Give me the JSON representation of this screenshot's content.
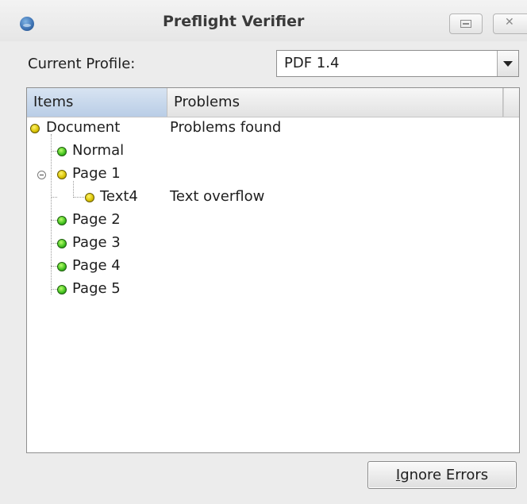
{
  "window": {
    "title": "Preflight Verifier"
  },
  "profile": {
    "label": "Current Profile:",
    "selected": "PDF 1.4"
  },
  "tree": {
    "columns": [
      "Items",
      "Problems"
    ],
    "rows": [
      {
        "label": "Document",
        "status": "yellow",
        "problem": "Problems found"
      },
      {
        "label": "Normal",
        "status": "green",
        "problem": ""
      },
      {
        "label": "Page 1",
        "status": "yellow",
        "problem": "",
        "expanded": true
      },
      {
        "label": "Text4",
        "status": "yellow",
        "problem": "Text overflow"
      },
      {
        "label": "Page 2",
        "status": "green",
        "problem": ""
      },
      {
        "label": "Page 3",
        "status": "green",
        "problem": ""
      },
      {
        "label": "Page 4",
        "status": "green",
        "problem": ""
      },
      {
        "label": "Page 5",
        "status": "green",
        "problem": ""
      }
    ]
  },
  "buttons": {
    "ignore_mnemonic": "I",
    "ignore_rest": "gnore Errors"
  },
  "colors": {
    "status_yellow": "#d8c200",
    "status_green": "#3fbf1e",
    "header_selected": "#b9cde6"
  },
  "icons": {
    "app": "globe-icon",
    "status_ok": "green-dot-icon",
    "status_warning": "yellow-dot-icon"
  }
}
